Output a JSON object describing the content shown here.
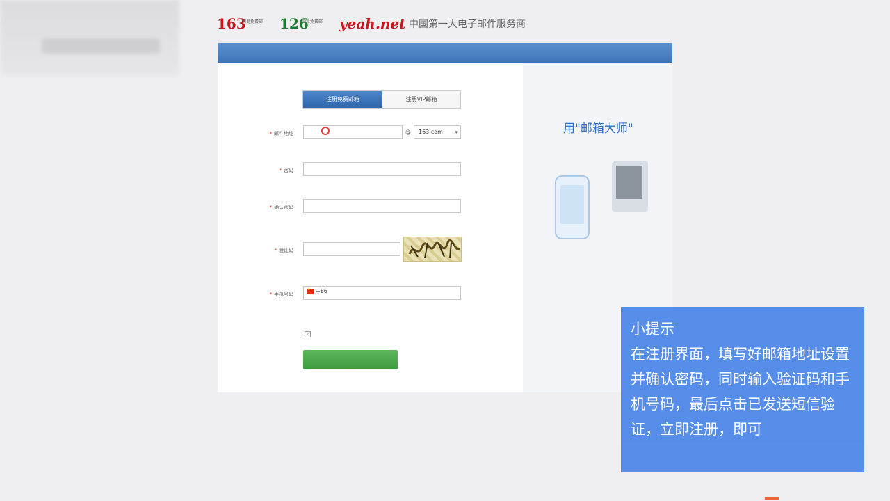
{
  "header": {
    "logo_163": "163",
    "logo_163_sub": "网易免费邮",
    "logo_126": "126",
    "logo_126_sub": "网易免费邮",
    "logo_yeah": "yeah.net",
    "logo_yeah_sub": "",
    "slogan": "中国第一大电子邮件服务商",
    "top_link": "",
    "brand_red": "#c7161c",
    "brand_green": "#1a7c2f"
  },
  "banner": {
    "text": "",
    "color": "#4a80c3"
  },
  "tabs": [
    {
      "label": "注册免费邮箱",
      "active": true
    },
    {
      "label": "注册VIP邮箱",
      "active": false
    }
  ],
  "form": {
    "email": {
      "label": "邮件地址",
      "value": "",
      "hint": "",
      "domain": "163.com",
      "at": "@"
    },
    "password": {
      "label": "密码",
      "value": "",
      "hint": ""
    },
    "confirm": {
      "label": "确认密码",
      "value": "",
      "hint": ""
    },
    "captcha": {
      "label": "验证码",
      "value": "",
      "hint": "",
      "refresh_link": "",
      "image_text": ""
    },
    "phone": {
      "label": "手机号码",
      "code": "+86",
      "hint": ""
    },
    "agree": {
      "text": ""
    },
    "submit": {
      "label": ""
    }
  },
  "side": {
    "title": "用\"邮箱大师\"",
    "subtitle": "",
    "caption": "",
    "features": [
      "",
      ""
    ],
    "accent": "#2d6fc1"
  },
  "footer": {
    "line1": "",
    "line2": ""
  },
  "tip": {
    "title": "小提示",
    "body": "在注册界面，填写好邮箱地址设置并确认密码，同时输入验证码和手机号码，最后点击已发送短信验证，立即注册，即可",
    "bg_color": "#4a86e8"
  },
  "icons": [
    "text-cursor-ring-icon",
    "china-flag-icon",
    "checkbox-icon",
    "phone-illustration-icon",
    "laptop-illustration-icon",
    "dropdown-arrow-icon"
  ]
}
